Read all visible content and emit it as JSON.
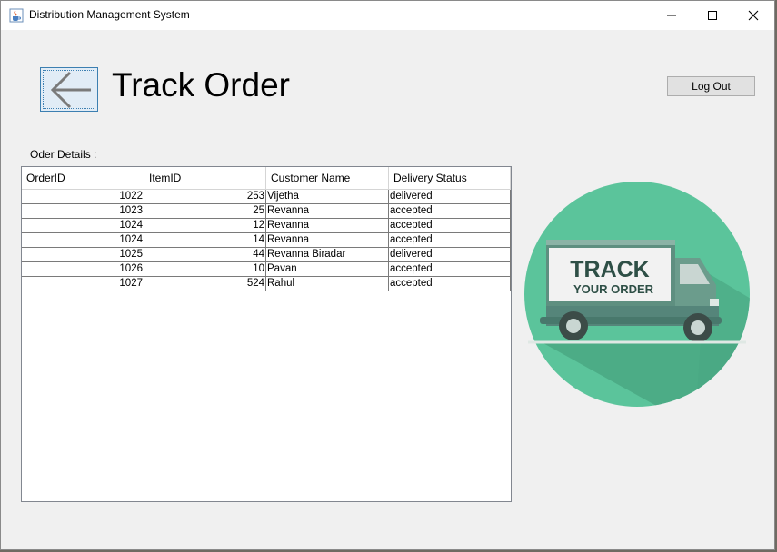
{
  "window": {
    "title": "Distribution Management System",
    "icons": {
      "app": "java-cup-icon",
      "minimize": "minimize-icon",
      "maximize": "maximize-icon",
      "close": "close-icon"
    }
  },
  "header": {
    "back_icon": "arrow-left-icon",
    "title": "Track Order",
    "logout_label": "Log Out"
  },
  "orders": {
    "section_label": "Oder Details :",
    "columns": [
      "OrderID",
      "ItemID",
      "Customer Name",
      "Delivery Status"
    ],
    "rows": [
      {
        "order_id": "1022",
        "item_id": "253",
        "customer": "Vijetha",
        "status": "delivered"
      },
      {
        "order_id": "1023",
        "item_id": "25",
        "customer": "Revanna",
        "status": "accepted"
      },
      {
        "order_id": "1024",
        "item_id": "12",
        "customer": "Revanna",
        "status": "accepted"
      },
      {
        "order_id": "1024",
        "item_id": "14",
        "customer": "Revanna",
        "status": "accepted"
      },
      {
        "order_id": "1025",
        "item_id": "44",
        "customer": "Revanna Biradar",
        "status": "delivered"
      },
      {
        "order_id": "1026",
        "item_id": "10",
        "customer": "Pavan",
        "status": "accepted"
      },
      {
        "order_id": "1027",
        "item_id": "524",
        "customer": "Rahul",
        "status": "accepted"
      }
    ]
  },
  "illustration": {
    "line1": "TRACK",
    "line2": "YOUR ORDER",
    "colors": {
      "circle": "#5bc49b",
      "truck": "#5e8f80",
      "panel": "#f2f2f2",
      "text": "#2e4f46"
    }
  }
}
